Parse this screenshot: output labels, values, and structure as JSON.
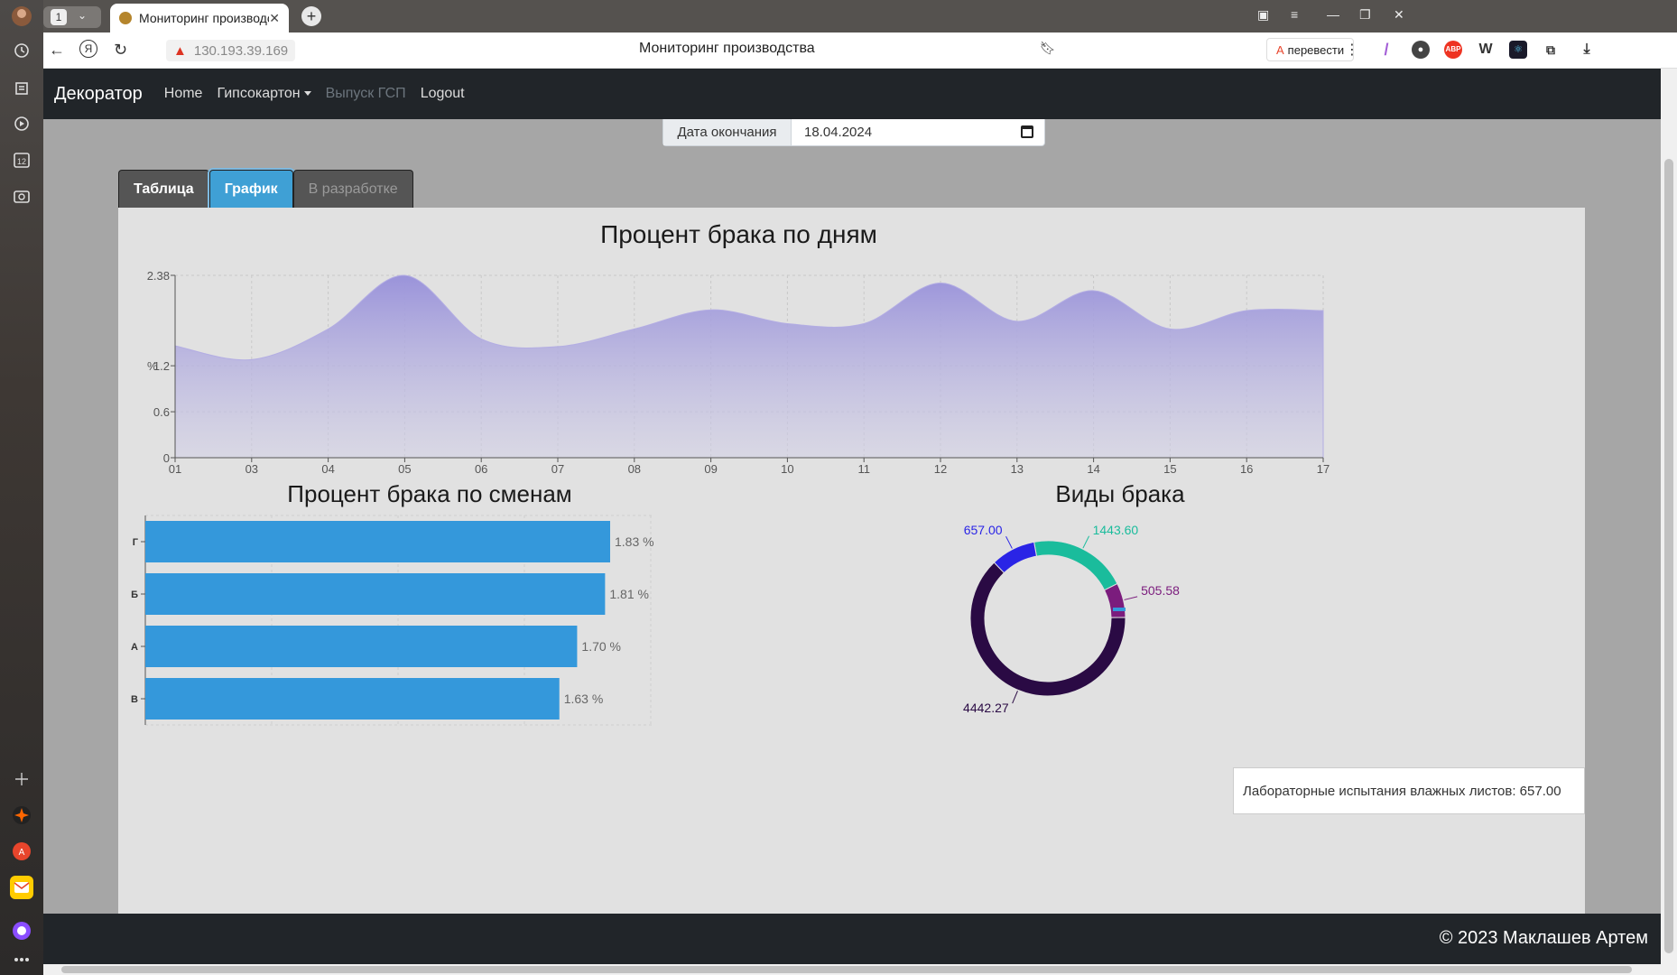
{
  "browser": {
    "tab_count": "1",
    "tab_title": "Мониторинг производства",
    "address": "130.193.39.169",
    "page_title": "Мониторинг производства",
    "translate_label": "перевести",
    "ext_abp": "ABP",
    "ext_w": "W"
  },
  "nav": {
    "brand": "Декоратор",
    "home": "Home",
    "drywall": "Гипсокартон",
    "release": "Выпуск ГСП",
    "logout": "Logout"
  },
  "date_filter": {
    "label": "Дата окончания",
    "value": "18.04.2024"
  },
  "tabs": [
    "Таблица",
    "График",
    "В разработке"
  ],
  "charts": {
    "daily": {
      "title": "Процент брака по дням",
      "y_axis_label": "%",
      "y_ticks": [
        "0",
        "0.6",
        "1.2",
        "2.38"
      ]
    },
    "shifts": {
      "title": "Процент брака по сменам"
    },
    "types": {
      "title": "Виды брака"
    }
  },
  "chart_data": [
    {
      "type": "area",
      "title": "Процент брака по дням",
      "ylabel": "%",
      "x": [
        "01",
        "03",
        "04",
        "05",
        "06",
        "07",
        "08",
        "09",
        "10",
        "11",
        "12",
        "13",
        "14",
        "15",
        "16",
        "17"
      ],
      "y": [
        1.46,
        1.28,
        1.68,
        2.38,
        1.55,
        1.45,
        1.68,
        1.93,
        1.75,
        1.75,
        2.28,
        1.78,
        2.18,
        1.68,
        1.92,
        1.92
      ],
      "ylim": [
        0,
        2.38
      ],
      "grid": true,
      "color": "#9b92d8"
    },
    {
      "type": "bar",
      "orientation": "horizontal",
      "title": "Процент брака по сменам",
      "categories": [
        "Г",
        "Б",
        "А",
        "В"
      ],
      "values": [
        1.83,
        1.81,
        1.7,
        1.63
      ],
      "labels": [
        "1.83 %",
        "1.81 %",
        "1.70 %",
        "1.63 %"
      ],
      "color": "#3498db"
    },
    {
      "type": "pie",
      "title": "Виды брака",
      "labels": [
        "1443.60",
        "505.58",
        "4442.27",
        "657.00"
      ],
      "values": [
        1443.6,
        505.58,
        4442.27,
        657.0
      ],
      "colors": [
        "#1abc9c",
        "#7b1c7d",
        "#2a0a44",
        "#2a24e6"
      ]
    }
  ],
  "tooltip": {
    "text": "Лабораторные испытания влажных листов: 657.00"
  },
  "footer": {
    "text": "© 2023 Маклашев Артем"
  }
}
